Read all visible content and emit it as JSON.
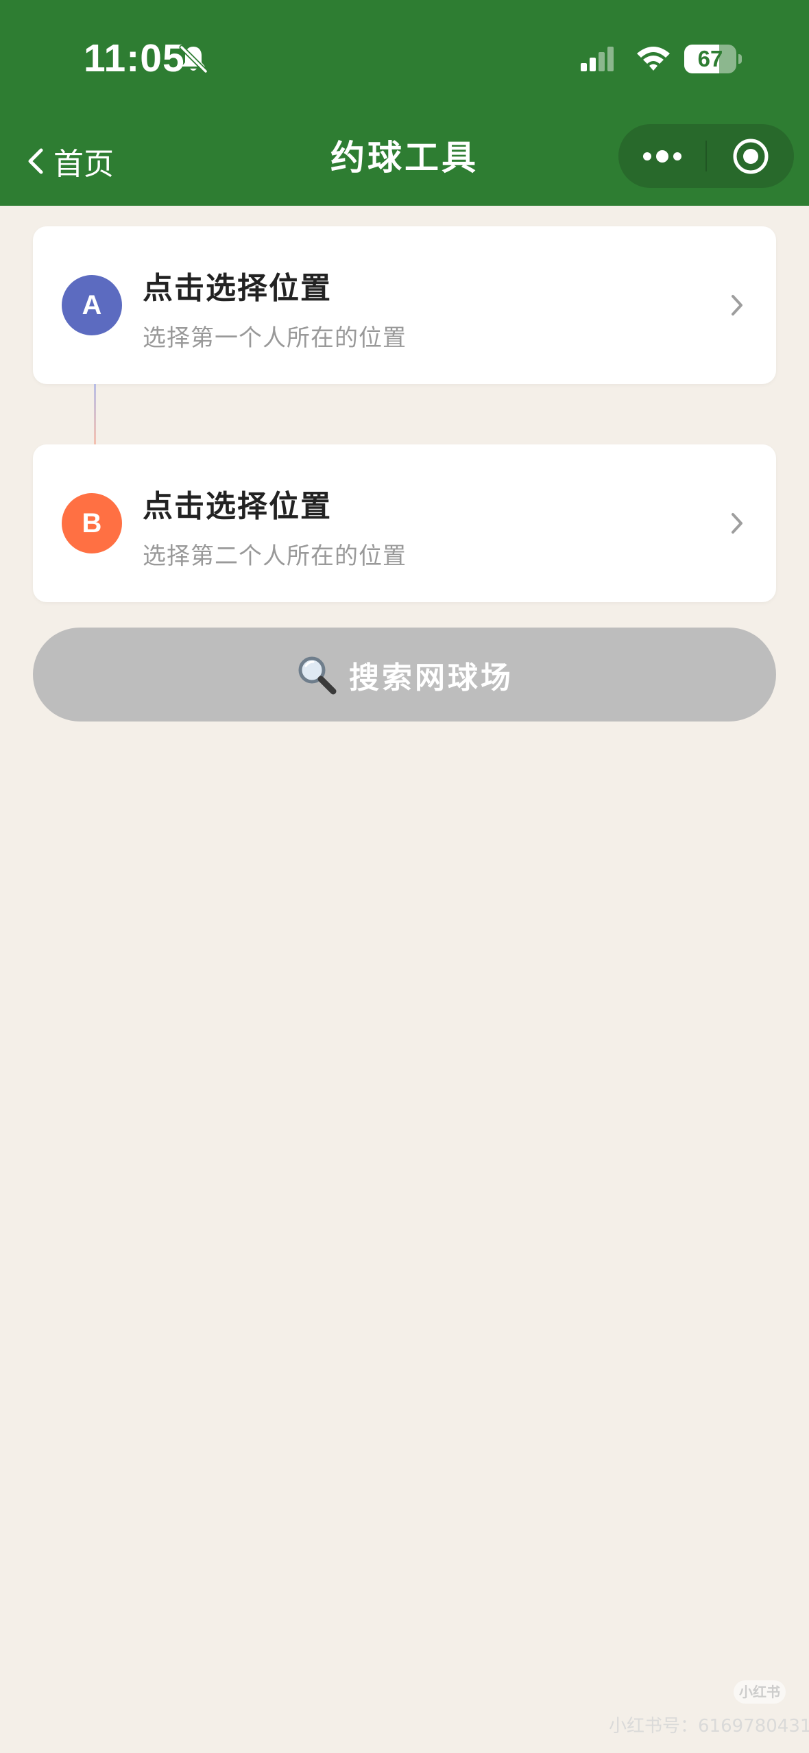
{
  "status_bar": {
    "time": "11:05",
    "battery_level": "67",
    "battery_fraction": 0.67,
    "icons": [
      "bell-slash-icon",
      "cellular-signal-icon",
      "wifi-icon",
      "battery-icon"
    ]
  },
  "nav": {
    "back_label": "首页",
    "title": "约球工具",
    "capsule_icons": [
      "more-dots-icon",
      "close-target-icon"
    ]
  },
  "locations": [
    {
      "badge": "A",
      "badge_color": "#5c6bc0",
      "title": "点击选择位置",
      "subtitle": "选择第一个人所在的位置"
    },
    {
      "badge": "B",
      "badge_color": "#ff7043",
      "title": "点击选择位置",
      "subtitle": "选择第二个人所在的位置"
    }
  ],
  "search_button": {
    "label": "搜索网球场",
    "icon": "magnifier-icon",
    "color": "#bdbdbd"
  },
  "watermark": {
    "logo": "小红书",
    "text": "小红书号：6169780431"
  },
  "colors": {
    "header": "#2e7d32",
    "background": "#f4efe8",
    "card": "#ffffff"
  }
}
